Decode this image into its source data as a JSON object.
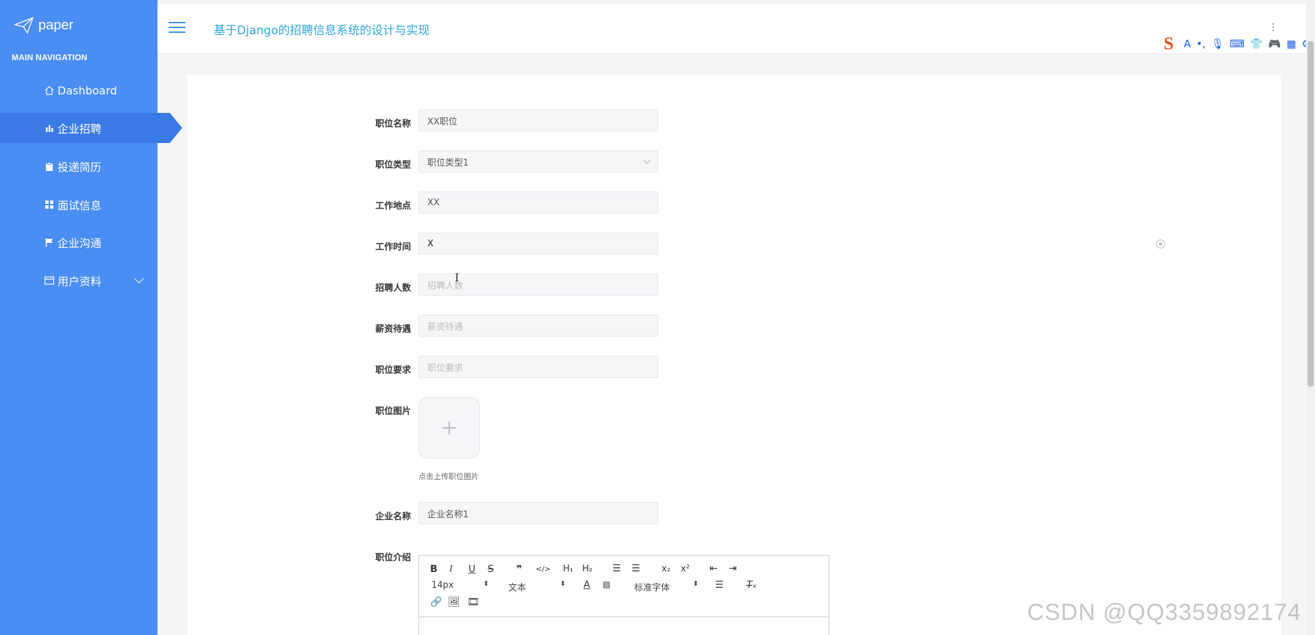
{
  "sidebar": {
    "logo_text": "paper",
    "nav_heading": "MAIN NAVIGATION",
    "items": [
      {
        "label": "Dashboard"
      },
      {
        "label": "企业招聘"
      },
      {
        "label": "投递简历"
      },
      {
        "label": "面试信息"
      },
      {
        "label": "企业沟通"
      },
      {
        "label": "用户资料"
      }
    ]
  },
  "header": {
    "title": "基于Django的招聘信息系统的设计与实现"
  },
  "form": {
    "position_name": {
      "label": "职位名称",
      "value": "XX职位"
    },
    "position_type": {
      "label": "职位类型",
      "value": "职位类型1"
    },
    "work_location": {
      "label": "工作地点",
      "value": "XX"
    },
    "work_time": {
      "label": "工作时间",
      "value": "X"
    },
    "headcount": {
      "label": "招聘人数",
      "placeholder": "招聘人数"
    },
    "salary": {
      "label": "薪资待遇",
      "placeholder": "薪资待遇"
    },
    "requirements": {
      "label": "职位要求",
      "placeholder": "职位要求"
    },
    "image": {
      "label": "职位图片",
      "hint": "点击上传职位图片"
    },
    "company_name": {
      "label": "企业名称",
      "value": "企业名称1"
    },
    "intro": {
      "label": "职位介绍"
    }
  },
  "editor": {
    "font_size": "14px",
    "text_type": "文本",
    "font_family": "标准字体"
  },
  "watermark": "CSDN @QQ3359892174",
  "colors": {
    "sidebar_bg": "#4a8df3",
    "sidebar_active": "#3a7ae4",
    "title_color": "#2fa4d9"
  }
}
